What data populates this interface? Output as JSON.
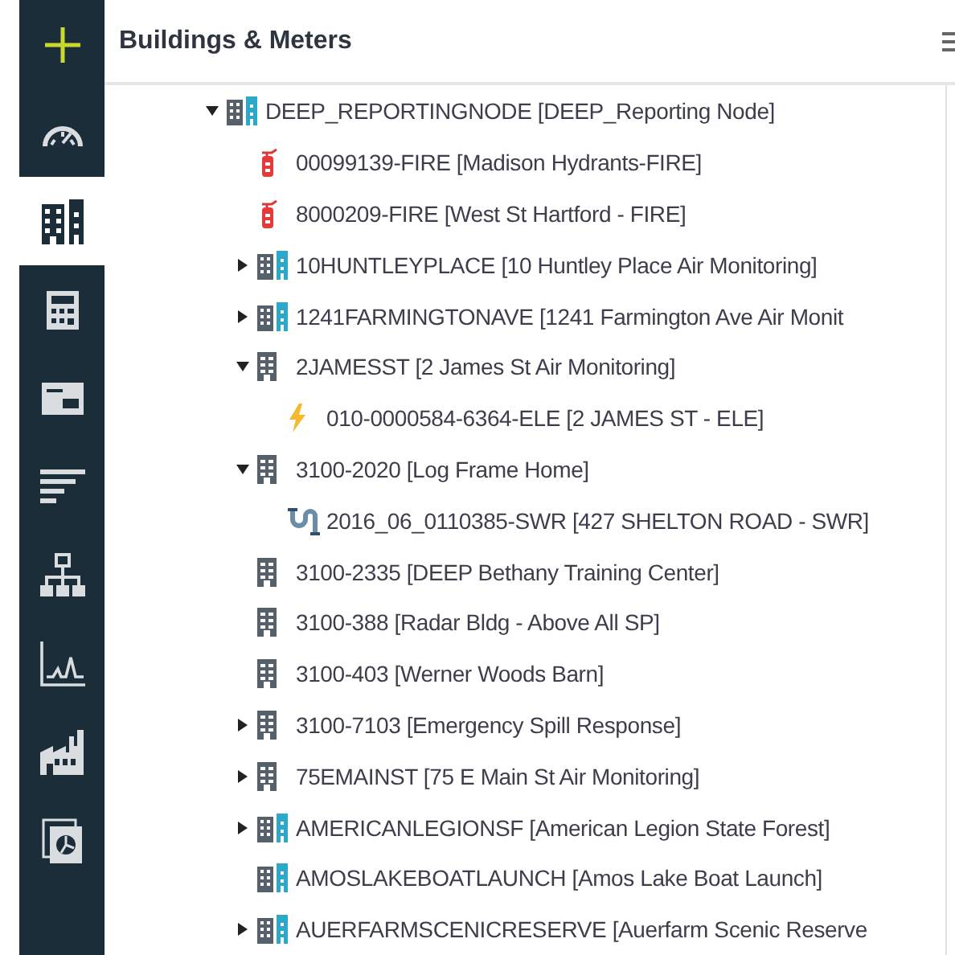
{
  "sidebar": {
    "items": [
      {
        "kind": "add",
        "selected": false
      },
      {
        "kind": "gauge",
        "selected": false
      },
      {
        "kind": "buildings",
        "selected": true
      },
      {
        "kind": "calculator",
        "selected": false
      },
      {
        "kind": "bill",
        "selected": false
      },
      {
        "kind": "list",
        "selected": false
      },
      {
        "kind": "hierarchy",
        "selected": false
      },
      {
        "kind": "chart",
        "selected": false
      },
      {
        "kind": "factory",
        "selected": false
      },
      {
        "kind": "report",
        "selected": false
      }
    ]
  },
  "panel": {
    "title": "Buildings & Meters"
  },
  "tree": [
    {
      "kind": "campus",
      "label": "DEEP_REPORTINGNODE [DEEP_Reporting Node]",
      "expanded": true,
      "children": [
        {
          "kind": "fire",
          "label": "00099139-FIRE [Madison Hydrants-FIRE]"
        },
        {
          "kind": "fire",
          "label": "8000209-FIRE [West St Hartford - FIRE]"
        },
        {
          "kind": "campus",
          "label": "10HUNTLEYPLACE [10 Huntley Place Air Monitoring]",
          "expanded": false
        },
        {
          "kind": "campus",
          "label": "1241FARMINGTONAVE [1241 Farmington Ave Air Monit",
          "expanded": false
        },
        {
          "kind": "building",
          "label": "2JAMESST [2 James St Air Monitoring]",
          "expanded": true,
          "children": [
            {
              "kind": "electric",
              "label": "010-0000584-6364-ELE [2 JAMES ST - ELE]"
            }
          ]
        },
        {
          "kind": "building",
          "label": "3100-2020 [Log Frame Home]",
          "expanded": true,
          "children": [
            {
              "kind": "sewer",
              "label": "2016_06_0110385-SWR [427 SHELTON ROAD - SWR]"
            }
          ]
        },
        {
          "kind": "building",
          "label": "3100-2335 [DEEP Bethany Training Center]"
        },
        {
          "kind": "building",
          "label": "3100-388 [Radar Bldg - Above All SP]"
        },
        {
          "kind": "building",
          "label": "3100-403 [Werner Woods Barn]"
        },
        {
          "kind": "building",
          "label": "3100-7103 [Emergency Spill Response]",
          "expanded": false
        },
        {
          "kind": "building",
          "label": "75EMAINST [75 E Main St Air Monitoring]",
          "expanded": false
        },
        {
          "kind": "campus",
          "label": "AMERICANLEGIONSF [American Legion State Forest]",
          "expanded": false
        },
        {
          "kind": "campus",
          "label": "AMOSLAKEBOATLAUNCH [Amos Lake Boat Launch]"
        },
        {
          "kind": "campus",
          "label": "AUERFARMSCENICRESERVE [Auerfarm Scenic Reserve",
          "expanded": false
        }
      ]
    }
  ]
}
